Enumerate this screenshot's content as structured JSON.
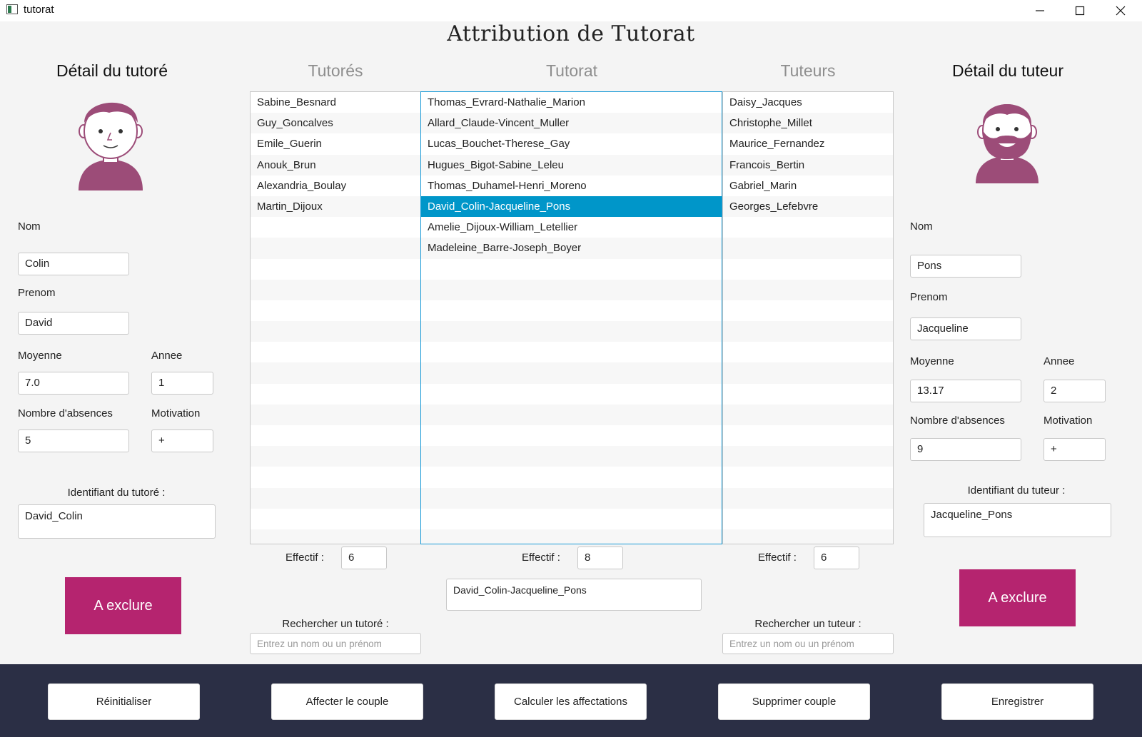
{
  "window": {
    "title": "tutorat",
    "minimize_glyph": "—",
    "maximize_glyph": "☐",
    "close_glyph": "✕"
  },
  "header": {
    "title": "Attribution de Tutorat"
  },
  "tutore_panel": {
    "title": "Détail du tutoré",
    "avatar_icon": "boy-avatar-icon",
    "nom_label": "Nom",
    "nom_value": "Colin",
    "prenom_label": "Prenom",
    "prenom_value": "David",
    "moyenne_label": "Moyenne",
    "moyenne_value": "7.0",
    "annee_label": "Annee",
    "annee_value": "1",
    "absences_label": "Nombre d'absences",
    "absences_value": "5",
    "motivation_label": "Motivation",
    "motivation_value": "+",
    "identifiant_label": "Identifiant du tutoré :",
    "identifiant_value": "David_Colin",
    "exclude_label": "A exclure"
  },
  "tuteur_panel": {
    "title": "Détail du tuteur",
    "avatar_icon": "bearded-man-avatar-icon",
    "nom_label": "Nom",
    "nom_value": "Pons",
    "prenom_label": "Prenom",
    "prenom_value": "Jacqueline",
    "moyenne_label": "Moyenne",
    "moyenne_value": "13.17",
    "annee_label": "Annee",
    "annee_value": "2",
    "absences_label": "Nombre d'absences",
    "absences_value": "9",
    "motivation_label": "Motivation",
    "motivation_value": "+",
    "identifiant_label": "Identifiant du tuteur  :",
    "identifiant_value": "Jacqueline_Pons",
    "exclude_label": "A exclure"
  },
  "columns": {
    "tutores": {
      "title": "Tutorés",
      "items": [
        "Sabine_Besnard",
        "Guy_Goncalves",
        "Emile_Guerin",
        "Anouk_Brun",
        "Alexandria_Boulay",
        "Martin_Dijoux"
      ],
      "effectif_label": "Effectif :",
      "effectif_value": "6",
      "search_label": "Rechercher un tutoré :",
      "search_placeholder": "Entrez un nom ou un prénom"
    },
    "tutorat": {
      "title": "Tutorat",
      "items": [
        "Thomas_Evrard-Nathalie_Marion",
        "Allard_Claude-Vincent_Muller",
        "Lucas_Bouchet-Therese_Gay",
        "Hugues_Bigot-Sabine_Leleu",
        "Thomas_Duhamel-Henri_Moreno",
        "David_Colin-Jacqueline_Pons",
        "Amelie_Dijoux-William_Letellier",
        "Madeleine_Barre-Joseph_Boyer"
      ],
      "selected_index": 5,
      "effectif_label": "Effectif :",
      "effectif_value": "8",
      "selected_value": "David_Colin-Jacqueline_Pons"
    },
    "tuteurs": {
      "title": "Tuteurs",
      "items": [
        "Daisy_Jacques",
        "Christophe_Millet",
        "Maurice_Fernandez",
        "Francois_Bertin",
        "Gabriel_Marin",
        "Georges_Lefebvre"
      ],
      "effectif_label": "Effectif :",
      "effectif_value": "6",
      "search_label": "Rechercher un tuteur :",
      "search_placeholder": "Entrez un nom ou un prénom"
    }
  },
  "footer": {
    "buttons": [
      "Réinitialiser",
      "Affecter le couple",
      "Calculer les affectations",
      "Supprimer couple",
      "Enregistrer"
    ]
  },
  "colors": {
    "accent": "#b5246f",
    "avatar": "#9c4c78",
    "selection": "#0096c9",
    "footer_bg": "#2b2f45"
  }
}
